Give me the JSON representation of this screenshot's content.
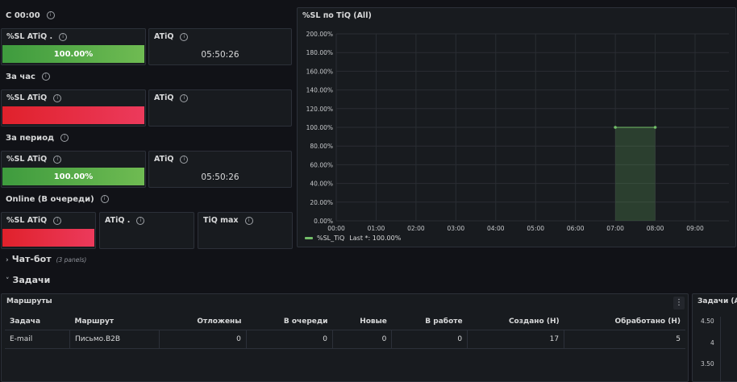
{
  "sections": {
    "since_midnight": "С 00:00",
    "per_hour": "За час",
    "per_period": "За период",
    "online": "Online (В очереди)"
  },
  "stats": {
    "row1": {
      "sl_title": "%SL ATiQ .",
      "sl_value": "100.00%",
      "atiq_title": "ATiQ",
      "atiq_value": "05:50:26"
    },
    "row2": {
      "sl_title": "%SL ATiQ",
      "atiq_title": "ATiQ"
    },
    "row3": {
      "sl_title": "%SL ATiQ",
      "sl_value": "100.00%",
      "atiq_title": "ATiQ",
      "atiq_value": "05:50:26"
    },
    "row4": {
      "sl_title": "%SL ATiQ",
      "atiq_title": "ATiQ .",
      "tiq_max_title": "TiQ max"
    },
    "colors": {
      "green": "#56a64b",
      "red": "#e02f44"
    }
  },
  "chart_panel": {
    "title": "%SL по TiQ (All)",
    "legend_label": "%SL_TiQ",
    "legend_stat": "Last *: 100.00%",
    "series_color": "#73bf69"
  },
  "chart_data": {
    "type": "area",
    "x_ticks": [
      "00:00",
      "01:00",
      "02:00",
      "03:00",
      "04:00",
      "05:00",
      "06:00",
      "07:00",
      "08:00",
      "09:00"
    ],
    "y_ticks": [
      "0.00%",
      "20.00%",
      "40.00%",
      "60.00%",
      "80.00%",
      "100.00%",
      "120.00%",
      "140.00%",
      "160.00%",
      "180.00%",
      "200.00%"
    ],
    "ylim": [
      0,
      200
    ],
    "series": [
      {
        "name": "%SL_TiQ",
        "x": [
          "07:00",
          "08:00"
        ],
        "values": [
          100,
          100
        ]
      }
    ],
    "grid": true,
    "legend": "bottom-left"
  },
  "rows": {
    "chatbot": {
      "label": "Чат-бот",
      "note": "(3 panels)"
    },
    "tasks": {
      "label": "Задачи"
    }
  },
  "routes_panel": {
    "title": "Маршруты",
    "columns": [
      "Задача",
      "Маршрут",
      "Отложены",
      "В очереди",
      "Новые",
      "В работе",
      "Создано (Н)",
      "Обработано (Н)"
    ],
    "rows": [
      [
        "E-mail",
        "Письмо.B2B",
        "0",
        "0",
        "0",
        "0",
        "17",
        "5"
      ]
    ]
  },
  "tasks_panel": {
    "title": "Задачи (All)",
    "y_ticks": [
      "4.50",
      "4",
      "3.50"
    ]
  }
}
